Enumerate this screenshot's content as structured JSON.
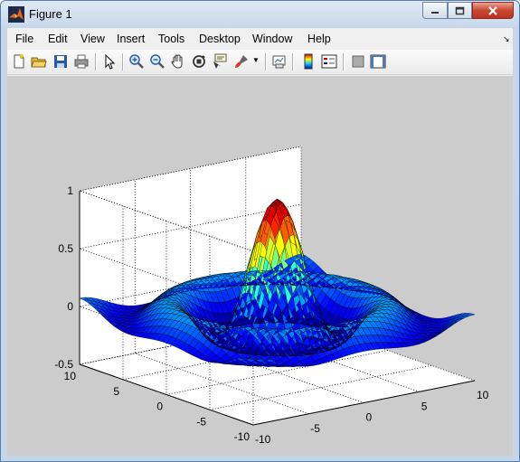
{
  "window": {
    "title": "Figure 1",
    "buttons": [
      "minimize",
      "maximize",
      "close"
    ]
  },
  "menu": {
    "items": [
      "File",
      "Edit",
      "View",
      "Insert",
      "Tools",
      "Desktop",
      "Window",
      "Help"
    ]
  },
  "toolbar": {
    "icons": [
      "new-figure-icon",
      "open-file-icon",
      "save-icon",
      "print-icon",
      "edit-plot-icon",
      "zoom-in-icon",
      "zoom-out-icon",
      "pan-icon",
      "rotate-3d-icon",
      "data-cursor-icon",
      "brush-icon",
      "link-plot-icon",
      "colorbar-icon",
      "legend-icon",
      "hide-plot-tools-icon",
      "show-plot-tools-icon"
    ]
  },
  "colors": {
    "figure_background": "#cccccc",
    "axes_background": "#ffffff",
    "colormap": "jet"
  },
  "chart_data": {
    "type": "surface",
    "function": "sinc(sqrt(x^2+y^2)) — peak 1 at center, ring minimum about -0.22",
    "xlim": [
      -10,
      10
    ],
    "ylim": [
      -10,
      10
    ],
    "zlim": [
      -0.5,
      1
    ],
    "xticks": [
      "-10",
      "-5",
      "0",
      "5",
      "10"
    ],
    "yticks": [
      "10",
      "5",
      "0",
      "-5",
      "-10"
    ],
    "zticks": [
      "1",
      "0.5",
      "0",
      "-0.5"
    ],
    "grid": true,
    "view": "default 3-D view (azimuth -37.5, elevation 30)"
  }
}
